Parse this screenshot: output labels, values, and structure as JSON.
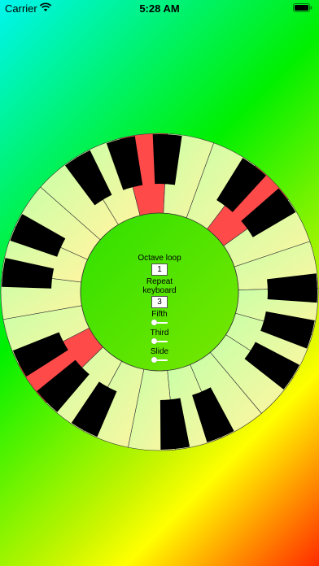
{
  "status_bar": {
    "carrier": "Carrier",
    "time": "5:28 AM"
  },
  "controls": {
    "octave_loop_label": "Octave loop",
    "octave_loop_value": "1",
    "repeat_keyboard_label_line1": "Repeat",
    "repeat_keyboard_label_line2": "keyboard",
    "repeat_keyboard_value": "3",
    "fifth_label": "Fifth",
    "fifth_value": 0,
    "third_label": "Third",
    "third_value": 0,
    "slide_label": "Slide",
    "slide_value": 0
  },
  "keyboard_wheel": {
    "white_keys_per_octave": 7,
    "octaves_shown": 3,
    "highlighted_white_keys": [
      5,
      8,
      19
    ],
    "colors": {
      "white_key_light": "#c8ffa8",
      "white_key_warm": "#fff5a0",
      "highlight": "#ff4a4a",
      "black_key": "#000000",
      "inner_circle": "#3ee000"
    }
  }
}
